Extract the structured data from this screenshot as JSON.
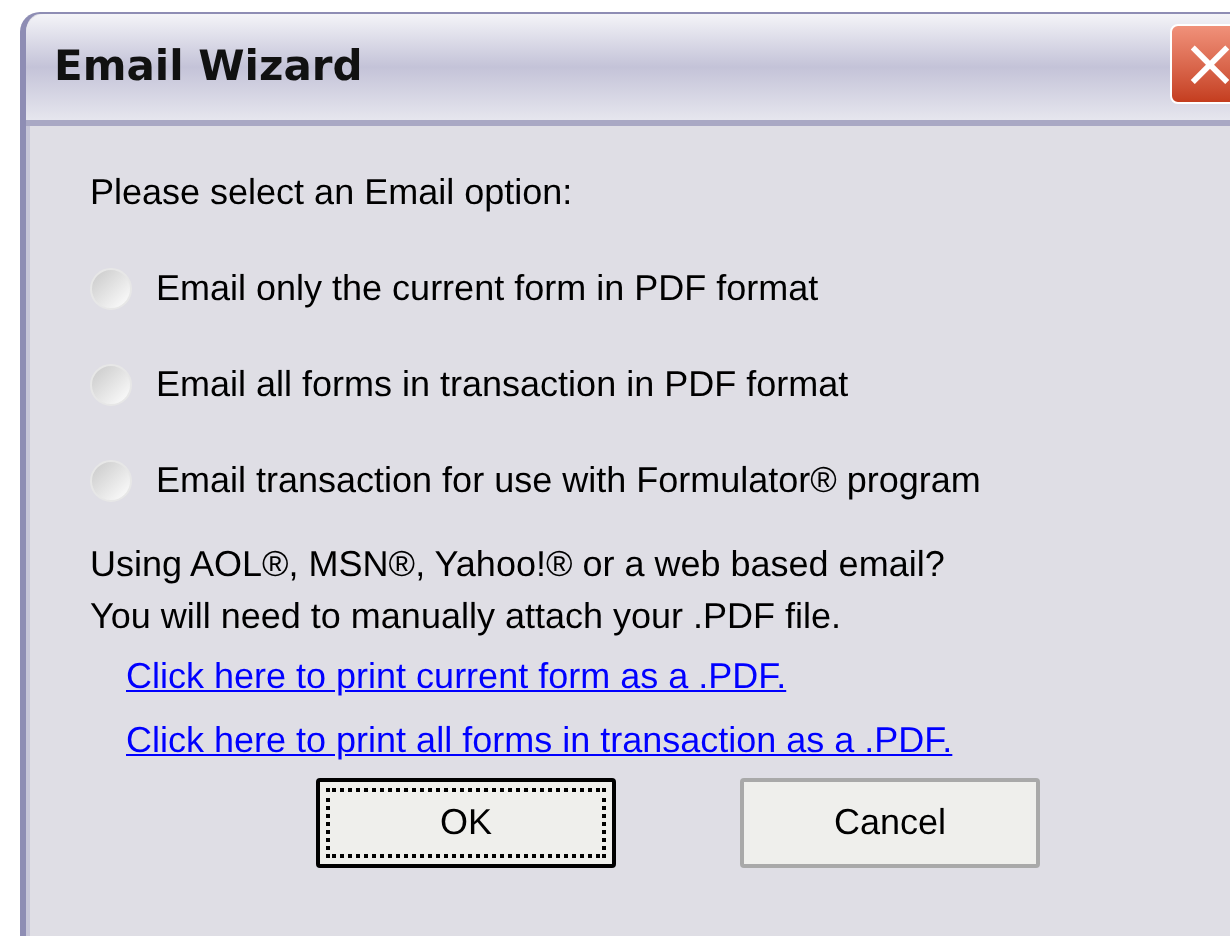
{
  "window": {
    "title": "Email Wizard",
    "close": "×"
  },
  "prompt": "Please select an Email option:",
  "options": [
    {
      "label": "Email only the current form in PDF format",
      "selected": false
    },
    {
      "label": "Email all forms in transaction in PDF format",
      "selected": false
    },
    {
      "label": "Email transaction for use with Formulator® program",
      "selected": false
    }
  ],
  "note": [
    "Using AOL®, MSN®, Yahoo!® or a web based email?",
    "You will need to manually attach your .PDF file."
  ],
  "links": [
    "Click here to print current form as a .PDF.",
    "Click here to print all forms in transaction as a .PDF."
  ],
  "buttons": [
    {
      "label": "OK",
      "focused": true
    },
    {
      "label": "Cancel",
      "focused": false
    }
  ]
}
